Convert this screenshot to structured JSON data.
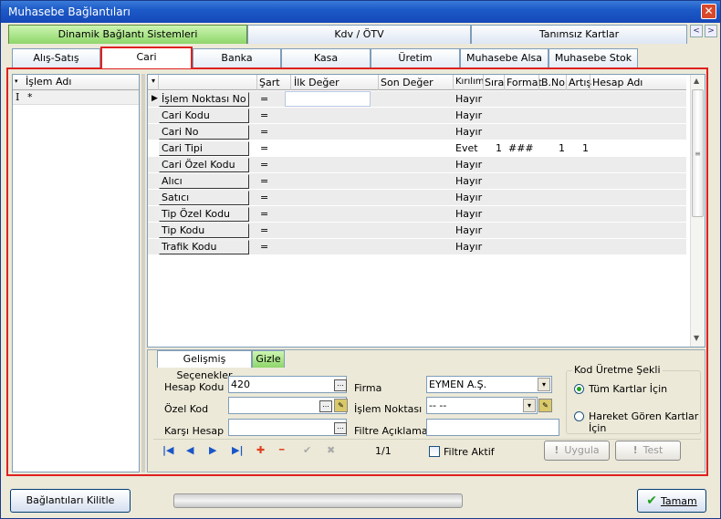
{
  "window": {
    "title": "Muhasebe Bağlantıları",
    "close": "✕"
  },
  "top_tabs": [
    "Dinamik Bağlantı Sistemleri",
    "Kdv / ÖTV",
    "Tanımsız Kartlar"
  ],
  "nav_arrows": {
    "left": "<",
    "right": ">"
  },
  "sub_tabs": [
    "Alış-Satış",
    "Cari",
    "Banka",
    "Kasa",
    "Üretim",
    "Muhasebe Alsa",
    "Muhasebe Stok"
  ],
  "active_sub_tab": "Cari",
  "left_list": {
    "header": "İşlem Adı",
    "dropdown": "▾",
    "row_marker": "I",
    "row_value": "*"
  },
  "grid": {
    "dropdown": "▾",
    "columns": [
      "Şart",
      "İlk Değer",
      "Son Değer",
      "Kırılım",
      "Sıra",
      "Format",
      "B.No",
      "Artış",
      "Hesap Adı"
    ],
    "rows": [
      {
        "name": "İşlem Noktası No",
        "sart": "=",
        "kirilim": "Hayır",
        "sira": "",
        "format": "",
        "bno": "",
        "artis": ""
      },
      {
        "name": "Cari Kodu",
        "sart": "=",
        "kirilim": "Hayır",
        "sira": "",
        "format": "",
        "bno": "",
        "artis": ""
      },
      {
        "name": "Cari No",
        "sart": "=",
        "kirilim": "Hayır",
        "sira": "",
        "format": "",
        "bno": "",
        "artis": ""
      },
      {
        "name": "Cari Tipi",
        "sart": "=",
        "kirilim": "Evet",
        "sira": "1",
        "format": "###",
        "bno": "1",
        "artis": "1"
      },
      {
        "name": "Cari Özel Kodu",
        "sart": "=",
        "kirilim": "Hayır",
        "sira": "",
        "format": "",
        "bno": "",
        "artis": ""
      },
      {
        "name": "Alıcı",
        "sart": "=",
        "kirilim": "Hayır",
        "sira": "",
        "format": "",
        "bno": "",
        "artis": ""
      },
      {
        "name": "Satıcı",
        "sart": "=",
        "kirilim": "Hayır",
        "sira": "",
        "format": "",
        "bno": "",
        "artis": ""
      },
      {
        "name": "Tip Özel Kodu",
        "sart": "=",
        "kirilim": "Hayır",
        "sira": "",
        "format": "",
        "bno": "",
        "artis": ""
      },
      {
        "name": "Tip Kodu",
        "sart": "=",
        "kirilim": "Hayır",
        "sira": "",
        "format": "",
        "bno": "",
        "artis": ""
      },
      {
        "name": "Trafik Kodu",
        "sart": "=",
        "kirilim": "Hayır",
        "sira": "",
        "format": "",
        "bno": "",
        "artis": ""
      }
    ],
    "scroll_up": "▲",
    "scroll_down": "▼",
    "scroll_grip": "≡"
  },
  "bottom_tabs": {
    "advanced": "Gelişmiş Seçenekler",
    "hide": "Gizle"
  },
  "form": {
    "hesap_kodu_label": "Hesap Kodu",
    "hesap_kodu_value": "420",
    "ozel_kod_label": "Özel Kod",
    "ozel_kod_value": "",
    "karsi_hesap_label": "Karşı Hesap",
    "karsi_hesap_value": "",
    "firma_label": "Firma",
    "firma_value": "EYMEN A.Ş.",
    "islem_noktasi_label": "İşlem Noktası",
    "islem_noktasi_value": "-- --",
    "filtre_label": "Filtre Açıklaması",
    "filtre_value": "",
    "ellipsis": "...",
    "drop": "▾"
  },
  "code_group": {
    "legend": "Kod Üretme Şekli",
    "option1": "Tüm Kartlar İçin",
    "option2": "Hareket Gören Kartlar İçin",
    "selected": "option1"
  },
  "navigator": {
    "first": "|◀",
    "prev": "◀",
    "next": "▶",
    "last": "▶|",
    "add": "✚",
    "remove": "━",
    "confirm": "✔",
    "cancel": "✖",
    "record": "1/1",
    "filter_label": "Filtre Aktif"
  },
  "actions": {
    "apply": "Uygula",
    "test": "Test",
    "warn": "!"
  },
  "footer": {
    "lock": "Bağlantıları Kilitle",
    "ok": "Tamam",
    "ok_icon": "✔"
  }
}
